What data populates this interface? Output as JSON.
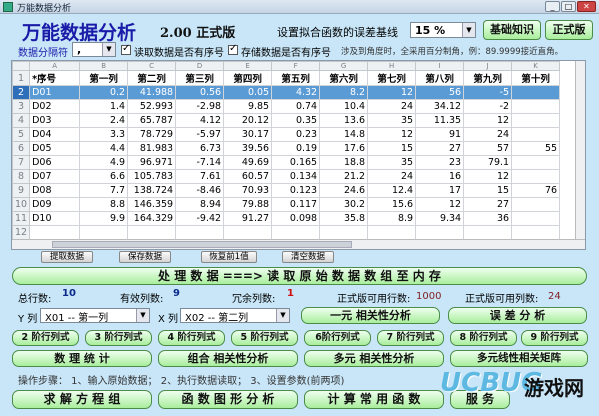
{
  "window": {
    "title": "万能数据分析"
  },
  "app": {
    "title": "万能数据分析",
    "version": "2.00 正式版"
  },
  "top": {
    "baseline_label": "设置拟合函数的误差基线",
    "baseline_value": "15 %",
    "btn_basic": "基础知识",
    "btn_official": "正式版"
  },
  "opts": {
    "separator_label": "数据分隔符",
    "separator_value": ",",
    "cb_read": "读取数据是否有序号",
    "cb_store": "存储数据是否有序号",
    "angle_note": "涉及到角度时，全采用百分制角，例：89.9999接近直角。"
  },
  "grid": {
    "col_letters": [
      "A",
      "B",
      "C",
      "D",
      "E",
      "F",
      "G",
      "H",
      "I",
      "J",
      "K"
    ],
    "headers": [
      "*序号",
      "第一列",
      "第二列",
      "第三列",
      "第四列",
      "第五列",
      "第六列",
      "第七列",
      "第八列",
      "第九列",
      "第十列"
    ],
    "row_numbers": [
      "1",
      "2",
      "3",
      "4",
      "5",
      "6",
      "7",
      "8",
      "9",
      "10",
      "11",
      "12"
    ],
    "rows": [
      [
        "D01",
        "0.2",
        "41.988",
        "0.56",
        "0.05",
        "4.32",
        "8.2",
        "12",
        "56",
        "-5",
        ""
      ],
      [
        "D02",
        "1.4",
        "52.993",
        "-2.98",
        "9.85",
        "0.74",
        "10.4",
        "24",
        "34.12",
        "-2",
        ""
      ],
      [
        "D03",
        "2.4",
        "65.787",
        "4.12",
        "20.12",
        "0.35",
        "13.6",
        "35",
        "11.35",
        "12",
        ""
      ],
      [
        "D04",
        "3.3",
        "78.729",
        "-5.97",
        "30.17",
        "0.23",
        "14.8",
        "12",
        "91",
        "24",
        ""
      ],
      [
        "D05",
        "4.4",
        "81.983",
        "6.73",
        "39.56",
        "0.19",
        "17.6",
        "15",
        "27",
        "57",
        "55"
      ],
      [
        "D06",
        "4.9",
        "96.971",
        "-7.14",
        "49.69",
        "0.165",
        "18.8",
        "35",
        "23",
        "79.1",
        ""
      ],
      [
        "D07",
        "6.6",
        "105.783",
        "7.61",
        "60.57",
        "0.134",
        "21.2",
        "24",
        "16",
        "12",
        ""
      ],
      [
        "D08",
        "7.7",
        "138.724",
        "-8.46",
        "70.93",
        "0.123",
        "24.6",
        "12.4",
        "17",
        "15",
        "76"
      ],
      [
        "D09",
        "8.8",
        "146.359",
        "8.94",
        "79.88",
        "0.117",
        "30.2",
        "15.6",
        "12",
        "27",
        ""
      ],
      [
        "D10",
        "9.9",
        "164.329",
        "-9.42",
        "91.27",
        "0.098",
        "35.8",
        "8.9",
        "9.34",
        "36",
        ""
      ]
    ]
  },
  "small_buttons": [
    "提取数据",
    "保存数据",
    "恢复前1值",
    "清空数据"
  ],
  "process_btn": "处 理 数 据 ===> 读 取 原 始 数 据 数 组 至 内 存",
  "stats": {
    "total_rows_label": "总行数:",
    "total_rows": "10",
    "valid_cols_label": "有效列数:",
    "valid_cols": "9",
    "redundant_label": "冗余列数:",
    "redundant": "1",
    "official_rows_label": "正式版可用行数:",
    "official_rows": "1000",
    "official_cols_label": "正式版可用列数:",
    "official_cols": "24"
  },
  "xy": {
    "y_label": "Y 列",
    "y_value": "X01 -- 第一列",
    "x_label": "X 列",
    "x_value": "X02 -- 第二列",
    "btn_corr": "一元 相关性分析",
    "btn_err": "误 差 分 析"
  },
  "order_btns": [
    "2 阶行列式",
    "3 阶行列式",
    "4 阶行列式",
    "5 阶行列式",
    "6阶行列式",
    "7 阶行列式",
    "8 阶行列式",
    "9 阶行列式"
  ],
  "row4": [
    "数 理 统 计",
    "组合 相关性分析",
    "多元 相关性分析",
    "多元线性相关矩阵"
  ],
  "steps": "操作步骤：  1、输入原始数据；  2、执行数据读取；  3、设置参数(前两项)",
  "bottom": [
    "求 解 方 程 组",
    "函 数 图 形 分 析",
    "计 算 常 用 函 数",
    "服 务"
  ],
  "watermark": {
    "logo": "UCBUG",
    "text": "游戏网"
  }
}
